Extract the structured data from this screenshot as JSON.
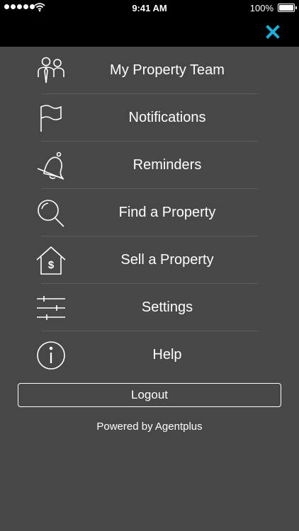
{
  "status_bar": {
    "time": "9:41 AM",
    "battery": "100%",
    "icons": [
      "signal-icon",
      "wifi-icon",
      "battery-icon"
    ]
  },
  "nav": {
    "close_icon": "close-icon",
    "accent_color": "#1ab0d8"
  },
  "menu": {
    "items": [
      {
        "label": "My Property Team",
        "icon": "team-icon"
      },
      {
        "label": "Notifications",
        "icon": "flag-icon"
      },
      {
        "label": "Reminders",
        "icon": "bell-off-icon"
      },
      {
        "label": "Find a Property",
        "icon": "search-icon"
      },
      {
        "label": "Sell a Property",
        "icon": "house-dollar-icon"
      },
      {
        "label": "Settings",
        "icon": "sliders-icon"
      },
      {
        "label": "Help",
        "icon": "info-icon"
      }
    ]
  },
  "logout_label": "Logout",
  "powered_by": "Powered by Agentplus",
  "colors": {
    "background": "#474747",
    "header": "#000000",
    "text": "#ffffff"
  }
}
